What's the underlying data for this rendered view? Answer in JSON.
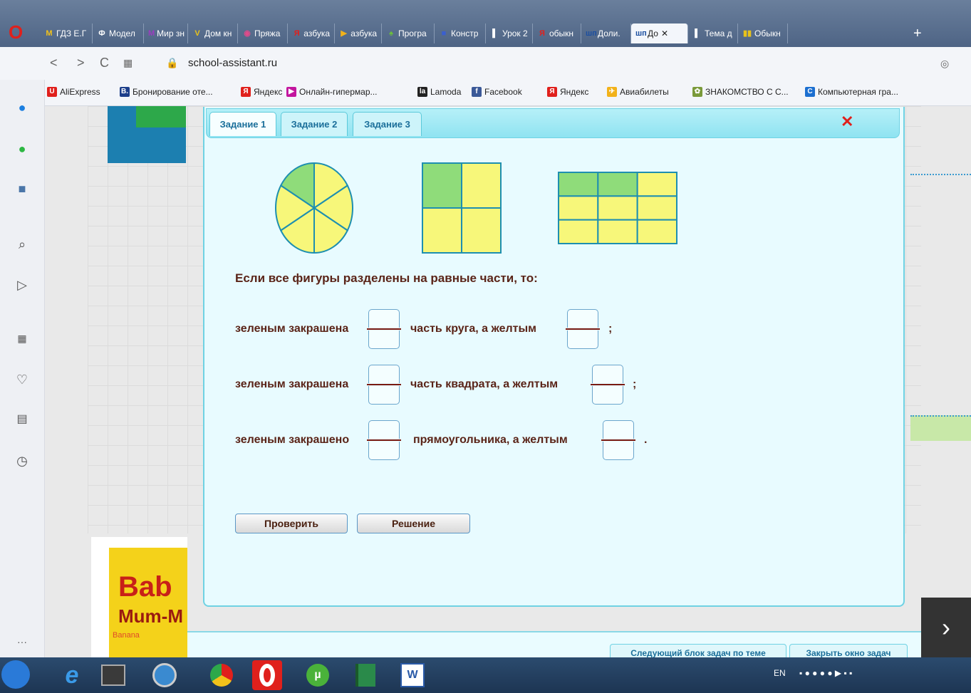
{
  "browser": {
    "tabs": [
      {
        "label": "ГДЗ Е.Г",
        "icon": "М",
        "color": "#f2c21a"
      },
      {
        "label": "Модел",
        "icon": "Ф",
        "color": "#ffffff"
      },
      {
        "label": "Мир зн",
        "icon": "M",
        "color": "#9b3dbf"
      },
      {
        "label": "Дом кн",
        "icon": "V",
        "color": "#e8c21a"
      },
      {
        "label": "Пряжа",
        "icon": "◉",
        "color": "#e04a8a"
      },
      {
        "label": "азбука",
        "icon": "Я",
        "color": "#e0201c"
      },
      {
        "label": "азбука",
        "icon": "▶",
        "color": "#f2b21a"
      },
      {
        "label": "Програ",
        "icon": "♠",
        "color": "#6bbf3a"
      },
      {
        "label": "Констр",
        "icon": "■",
        "color": "#3a5fd0"
      },
      {
        "label": "Урок 2",
        "icon": "▌",
        "color": "#ffffff"
      },
      {
        "label": "обыкн",
        "icon": "Я",
        "color": "#e0201c"
      },
      {
        "label": "Доли.",
        "icon": "шп",
        "color": "#1c4fa0"
      },
      {
        "label": "До",
        "icon": "шп",
        "color": "#1c4fa0",
        "active": true
      },
      {
        "label": "Тема д",
        "icon": "▌",
        "color": "#ffffff"
      },
      {
        "label": "Обыкн",
        "icon": "▮▮",
        "color": "#e8c21a"
      }
    ],
    "url": "school-assistant.ru",
    "bookmarks": [
      {
        "label": "AliExpress",
        "icon": "U",
        "color": "#e0201c"
      },
      {
        "label": "Бронирование оте...",
        "icon": "B.",
        "color": "#1c3e8a"
      },
      {
        "label": "Яндекс",
        "icon": "Я",
        "color": "#e0201c"
      },
      {
        "label": "Онлайн-гипермар...",
        "icon": "▶",
        "color": "#c3159e"
      },
      {
        "label": "Lamoda",
        "icon": "la",
        "color": "#222222"
      },
      {
        "label": "Facebook",
        "icon": "f",
        "color": "#3b5998"
      },
      {
        "label": "Яндекс",
        "icon": "Я",
        "color": "#e0201c"
      },
      {
        "label": "Авиабилеты",
        "icon": "✈",
        "color": "#f2b21a"
      },
      {
        "label": "ЗНАКОМСТВО С С...",
        "icon": "✿",
        "color": "#7a9a3a"
      },
      {
        "label": "Компьютерная гра...",
        "icon": "C",
        "color": "#1c6fd0"
      }
    ]
  },
  "exercise": {
    "tabs": [
      "Задание 1",
      "Задание 2",
      "Задание 3"
    ],
    "close_icon": "✕",
    "prompt": "Если все фигуры разделены на равные части, то:",
    "rows": [
      {
        "left": "зеленым закрашена",
        "middle": "часть круга,   а желтым",
        "end": ";"
      },
      {
        "left": "зеленым закрашена",
        "middle": "часть квадрата,   а желтым",
        "end": ";"
      },
      {
        "left": "зеленым закрашено",
        "middle": "прямоугольника,   а желтым",
        "end": "."
      }
    ],
    "buttons": {
      "check": "Проверить",
      "solution": "Решение"
    },
    "shapes": {
      "circle": {
        "parts": 6,
        "green": 1
      },
      "square": {
        "parts": 4,
        "green": 1
      },
      "rectangle": {
        "parts": 9,
        "green": 2
      }
    },
    "colors": {
      "green": "#8fdc7a",
      "yellow": "#f7f77a",
      "stroke": "#1e8fb0"
    }
  },
  "page_bottom": {
    "next_block": "Следующий блок задач по теме",
    "close_window": "Закрыть окно задач"
  },
  "ad": {
    "line1": "Bab",
    "line2": "Mum-M",
    "line3": "Banana"
  },
  "taskbar": {
    "language": "EN"
  }
}
